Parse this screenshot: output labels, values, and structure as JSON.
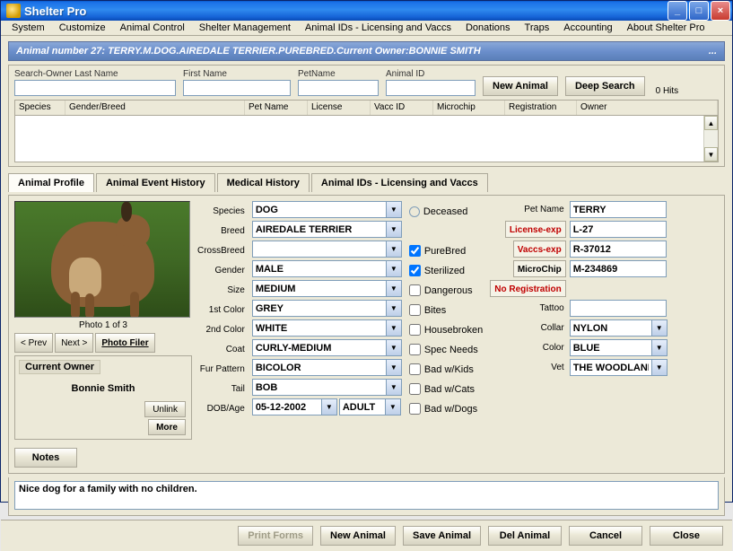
{
  "title": "Shelter Pro",
  "menu": {
    "system": "System",
    "customize": "Customize",
    "animalControl": "Animal Control",
    "shelterMgmt": "Shelter Management",
    "animalIds": "Animal IDs - Licensing and Vaccs",
    "donations": "Donations",
    "traps": "Traps",
    "accounting": "Accounting",
    "about": "About Shelter Pro"
  },
  "banner": "Animal number 27: TERRY.M.DOG.AIREDALE TERRIER.PUREBRED.Current Owner:BONNIE SMITH",
  "bannerEllipsis": "...",
  "search": {
    "labels": {
      "lastName": "Search-Owner Last Name",
      "firstName": "First Name",
      "petName": "PetName",
      "animalId": "Animal ID"
    },
    "newAnimal": "New Animal",
    "deepSearch": "Deep Search",
    "hits": "0 Hits"
  },
  "grid": {
    "species": "Species",
    "genderBreed": "Gender/Breed",
    "petName": "Pet Name",
    "license": "License",
    "vaccId": "Vacc ID",
    "microchip": "Microchip",
    "registration": "Registration",
    "owner": "Owner"
  },
  "tabs": {
    "profile": "Animal Profile",
    "eventHistory": "Animal Event History",
    "medical": "Medical History",
    "ids": "Animal IDs - Licensing and Vaccs"
  },
  "photo": {
    "caption": "Photo 1 of 3",
    "prev": "< Prev",
    "next": "Next >",
    "filer": "Photo Filer"
  },
  "owner": {
    "title": "Current Owner",
    "name": "Bonnie Smith",
    "unlink": "Unlink",
    "more": "More"
  },
  "form": {
    "labels": {
      "species": "Species",
      "breed": "Breed",
      "crossBreed": "CrossBreed",
      "gender": "Gender",
      "size": "Size",
      "c1": "1st Color",
      "c2": "2nd Color",
      "coat": "Coat",
      "fur": "Fur Pattern",
      "tail": "Tail",
      "dob": "DOB/Age"
    },
    "values": {
      "species": "DOG",
      "breed": "AIREDALE TERRIER",
      "crossBreed": "",
      "gender": "MALE",
      "size": "MEDIUM",
      "c1": "GREY",
      "c2": "WHITE",
      "coat": "CURLY-MEDIUM",
      "fur": "BICOLOR",
      "tail": "BOB",
      "dob": "05-12-2002",
      "age": "ADULT"
    }
  },
  "checks": {
    "deceased": "Deceased",
    "purebred": "PureBred",
    "sterilized": "Sterilized",
    "dangerous": "Dangerous",
    "bites": "Bites",
    "housebroken": "Housebroken",
    "specNeeds": "Spec Needs",
    "badKids": "Bad w/Kids",
    "badCats": "Bad w/Cats",
    "badDogs": "Bad w/Dogs"
  },
  "right": {
    "labels": {
      "petName": "Pet Name",
      "licenseExp": "License-exp",
      "vaccsExp": "Vaccs-exp",
      "microchip": "MicroChip",
      "noReg": "No Registration",
      "tattoo": "Tattoo",
      "collar": "Collar",
      "color": "Color",
      "vet": "Vet"
    },
    "values": {
      "petName": "TERRY",
      "license": "L-27",
      "vaccs": "R-37012",
      "microchip": "M-234869",
      "tattoo": "",
      "collar": "NYLON",
      "color": "BLUE",
      "vet": "THE WOODLANDS VET"
    }
  },
  "notes": {
    "btn": "Notes",
    "text": "Nice dog for a family with no children."
  },
  "bottom": {
    "print": "Print Forms",
    "new": "New Animal",
    "save": "Save Animal",
    "del": "Del Animal",
    "cancel": "Cancel",
    "close": "Close"
  }
}
